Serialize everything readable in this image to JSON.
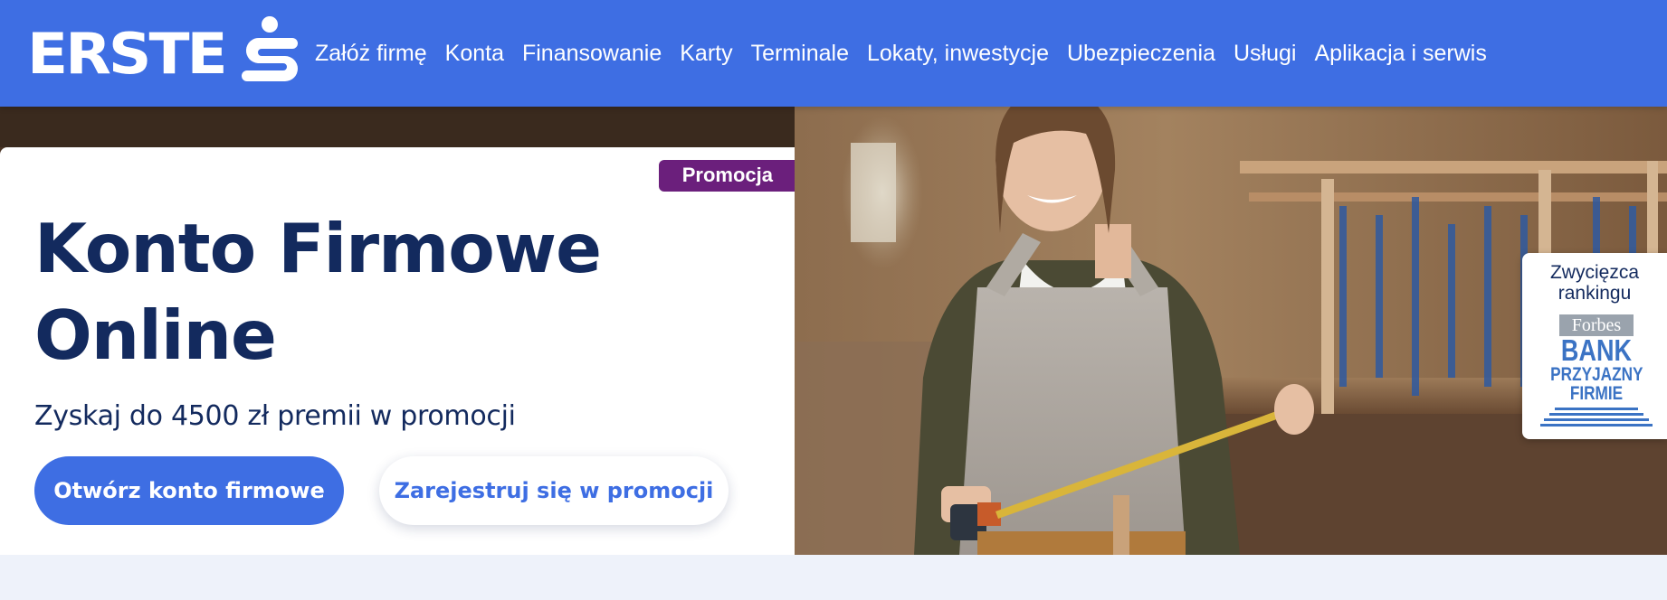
{
  "header": {
    "logo_text": "ERSTE",
    "nav": [
      {
        "label": "Załóż firmę"
      },
      {
        "label": "Konta"
      },
      {
        "label": "Finansowanie"
      },
      {
        "label": "Karty"
      },
      {
        "label": "Terminale"
      },
      {
        "label": "Lokaty, inwestycje"
      },
      {
        "label": "Ubezpieczenia"
      },
      {
        "label": "Usługi"
      },
      {
        "label": "Aplikacja i serwis"
      }
    ]
  },
  "hero": {
    "badge": "Promocja",
    "title_line1": "Konto Firmowe",
    "title_line2": "Online",
    "subtitle": "Zyskaj do 4500 zł premii w promocji",
    "primary_cta": "Otwórz konto firmowe",
    "secondary_cta": "Zarejestruj się w promocji"
  },
  "award": {
    "caption_line1": "Zwycięzca",
    "caption_line2": "rankingu",
    "badge_brand": "Forbes",
    "badge_line1": "BANK",
    "badge_line2": "PRZYJAZNY",
    "badge_line3": "FIRMIE"
  },
  "colors": {
    "brand_blue": "#3e6ee3",
    "navy_text": "#132a5e",
    "promo_purple": "#6b1f7c",
    "page_background": "#eef2fa"
  }
}
